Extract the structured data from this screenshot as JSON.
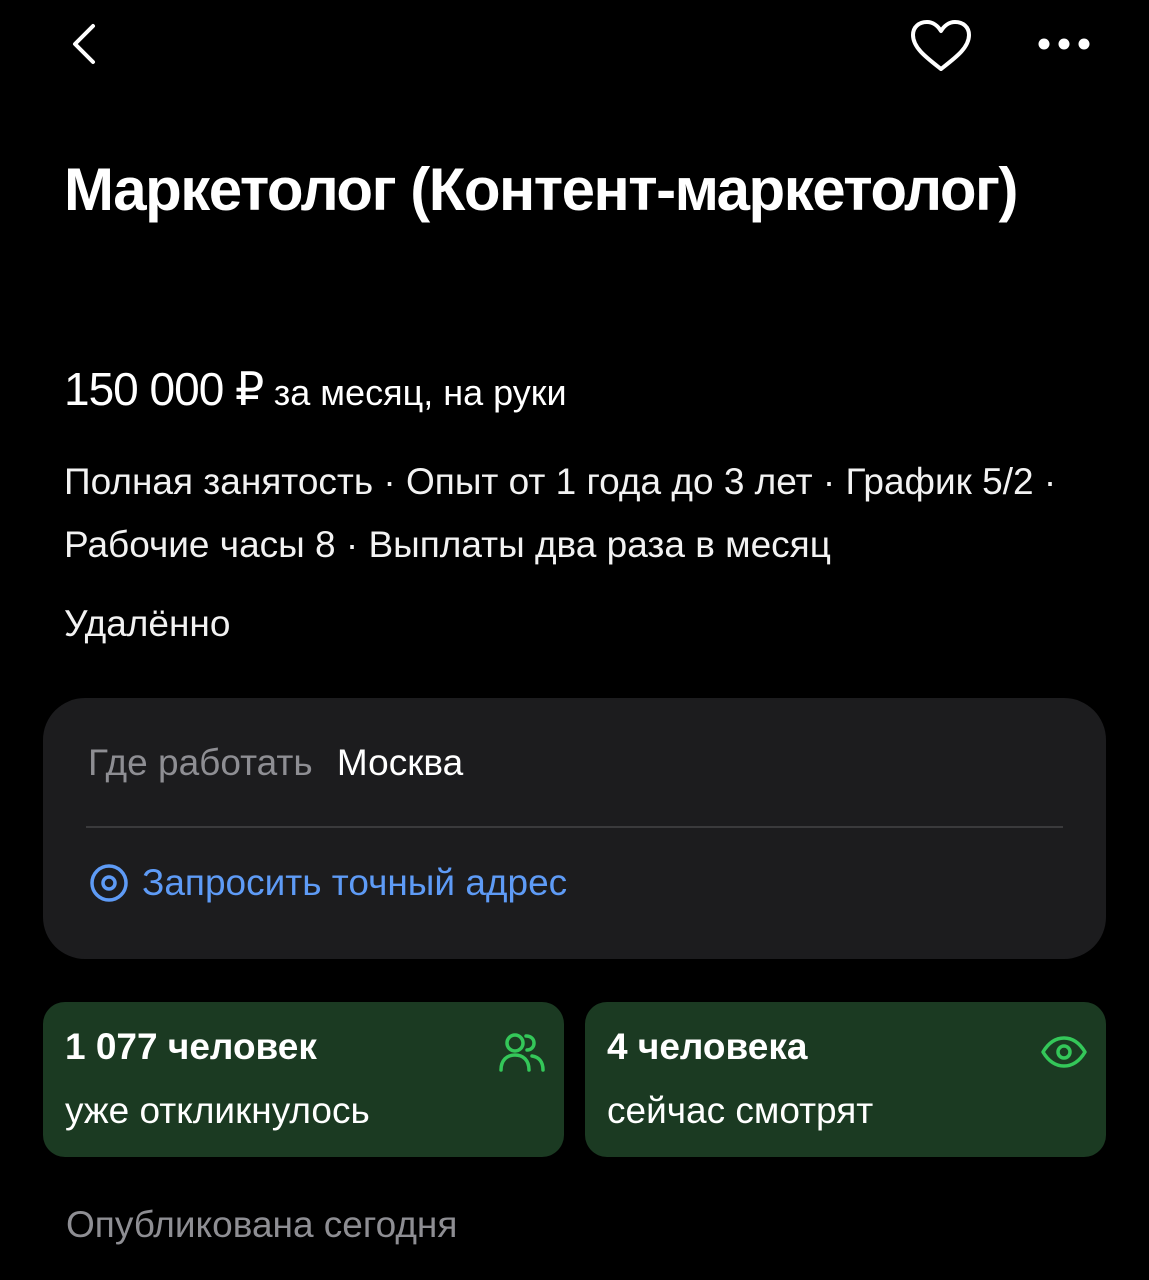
{
  "header": {
    "back_icon": "chevron-left-icon",
    "favorite_icon": "heart-outline-icon",
    "more_icon": "more-horizontal-icon"
  },
  "vacancy": {
    "title": "Маркетолог (Контент-маркетолог)",
    "salary_amount": "150 000 ₽",
    "salary_note": "за месяц, на руки",
    "conditions": "Полная занятость · Опыт от 1 года до 3 лет · График 5/2 · Рабочие часы 8 · Выплаты два раза в месяц",
    "work_format": "Удалённо"
  },
  "location": {
    "label": "Где работать",
    "city": "Москва",
    "request_address_label": "Запросить точный адрес",
    "request_icon": "location-pin-icon"
  },
  "stats": {
    "responses": {
      "count": "1 077 человек",
      "description": "уже откликнулось",
      "icon": "people-icon"
    },
    "viewers": {
      "count": "4 человека",
      "description": "сейчас смотрят",
      "icon": "eye-icon"
    }
  },
  "published": "Опубликована сегодня",
  "colors": {
    "background": "#000000",
    "card": "#1c1c1e",
    "stat_card": "#1b3a22",
    "accent_green": "#34c759",
    "link_blue": "#5e9bf6",
    "muted_text": "#8e8e93"
  }
}
